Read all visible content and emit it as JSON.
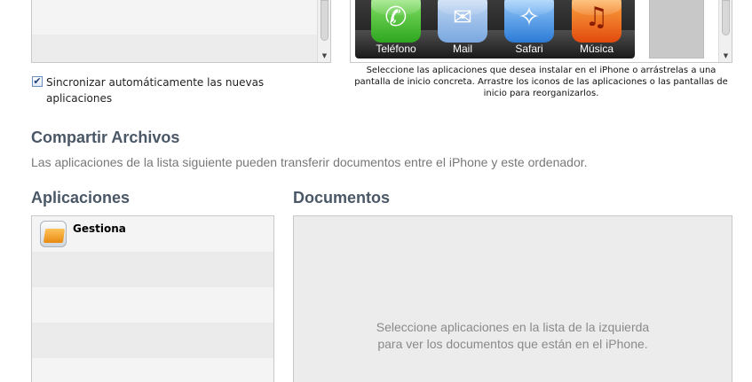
{
  "sync_apps": {
    "auto_sync_label": "Sincronizar automáticamente las nuevas aplicaciones",
    "auto_sync_checked": true,
    "checkbox_glyph": "✔"
  },
  "home_screen": {
    "dock_apps": [
      {
        "label": "Teléfono",
        "icon": "phone-icon",
        "glyph": "✆",
        "color": "#2ea61f"
      },
      {
        "label": "Mail",
        "icon": "mail-icon",
        "glyph": "✉",
        "color": "#7aa8e0"
      },
      {
        "label": "Safari",
        "icon": "safari-icon",
        "glyph": "✧",
        "color": "#2d7bd6"
      },
      {
        "label": "Música",
        "icon": "music-icon",
        "glyph": "♫",
        "color": "#e24a0e"
      }
    ],
    "instructions": "Seleccione las aplicaciones que desea instalar en el iPhone o arrástrelas a una pantalla de inicio concreta. Arrastre los iconos de las aplicaciones o las pantallas de inicio para reorganizarlos."
  },
  "file_sharing": {
    "title": "Compartir Archivos",
    "description": "Las aplicaciones de la lista siguiente pueden transferir documentos entre el iPhone y este ordenador.",
    "apps_heading": "Aplicaciones",
    "docs_heading": "Documentos",
    "apps": [
      {
        "name": "Gestiona",
        "icon": "gestiona-app-icon"
      }
    ],
    "docs_empty_text_line1": "Seleccione aplicaciones en la lista de la izquierda",
    "docs_empty_text_line2": "para ver los documentos que están en el iPhone."
  },
  "scroll_arrow_glyph": "▼"
}
